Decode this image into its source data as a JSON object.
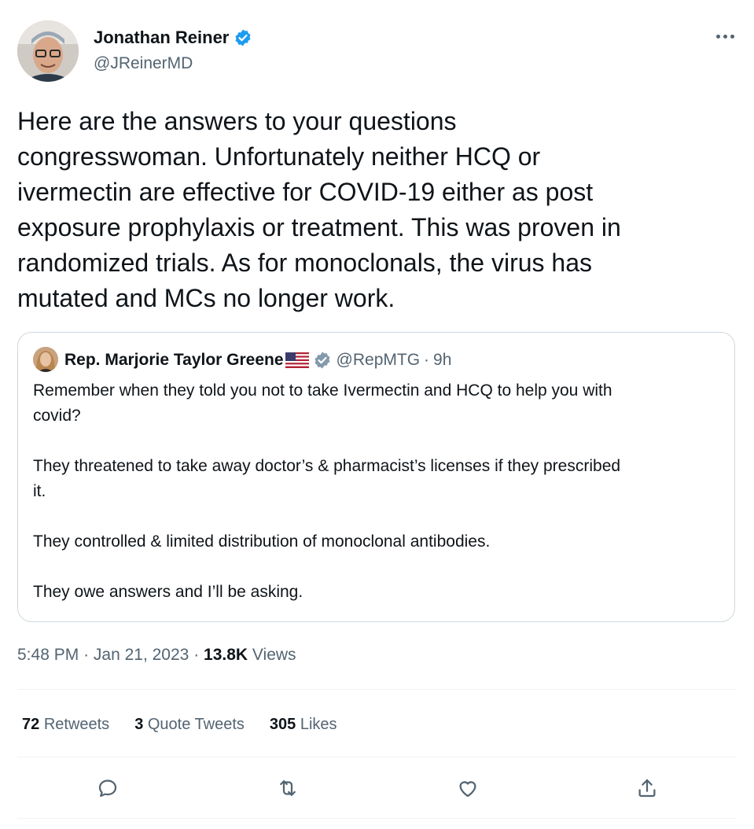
{
  "author": {
    "name": "Jonathan Reiner",
    "handle": "@JReinerMD",
    "verified": true,
    "badge_color": "#1d9bf0"
  },
  "tweet": {
    "text": "Here are the answers to your questions\ncongresswoman.  Unfortunately neither HCQ or\nivermectin are effective for COVID-19 either as post\nexposure prophylaxis or treatment. This was proven in\nrandomized trials. As for monoclonals, the virus has\nmutated and MCs no longer work.",
    "time": "5:48 PM",
    "separator": "·",
    "date": "Jan 21, 2023",
    "views_count": "13.8K",
    "views_label": "Views"
  },
  "quoted_tweet": {
    "name": "Rep. Marjorie Taylor Greene",
    "flag_icon": "us-flag-icon",
    "badge_icon": "gray-verified-badge-icon",
    "badge_color": "#829aab",
    "handle": "@RepMTG",
    "separator": "·",
    "age": "9h",
    "text": "Remember when they told you not to take Ivermectin and HCQ to help you with\ncovid?\n\nThey threatened to take away doctor’s & pharmacist’s licenses if they prescribed\nit.\n\nThey controlled & limited distribution of monoclonal antibodies.\n\nThey owe answers and I’ll be asking."
  },
  "stats": {
    "retweets_count": "72",
    "retweets_label": "Retweets",
    "quotes_count": "3",
    "quotes_label": "Quote Tweets",
    "likes_count": "305",
    "likes_label": "Likes"
  },
  "actions": {
    "icons": [
      "reply-icon",
      "retweet-icon",
      "like-icon",
      "share-icon"
    ],
    "icon_color": "#536471"
  }
}
